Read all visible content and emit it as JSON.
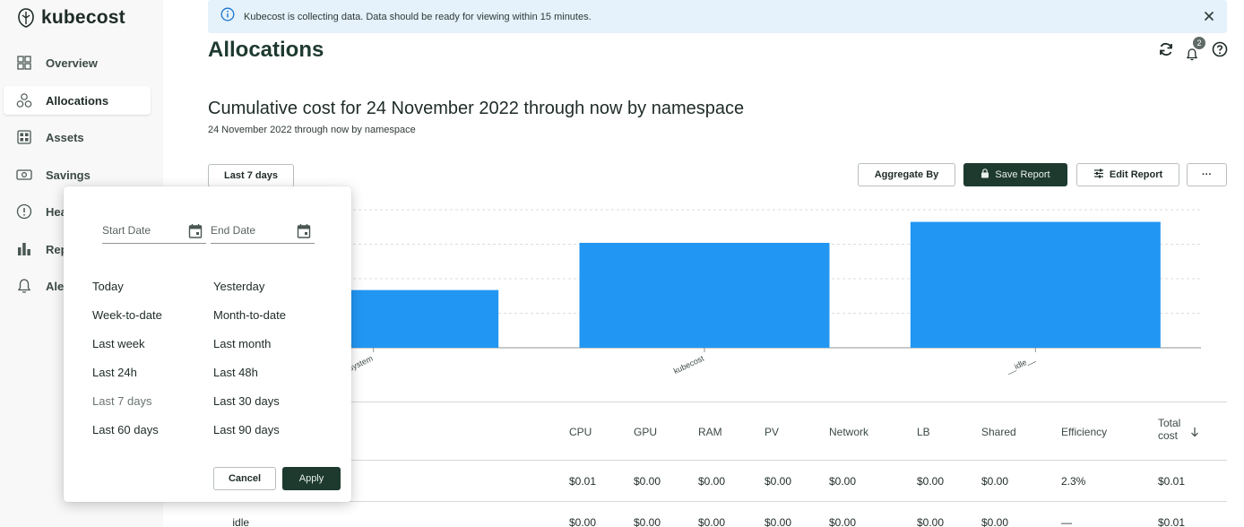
{
  "app": {
    "name": "kubecost"
  },
  "sidebar": {
    "items": [
      {
        "label": "Overview",
        "icon": "grid-icon"
      },
      {
        "label": "Allocations",
        "icon": "allocations-icon"
      },
      {
        "label": "Assets",
        "icon": "assets-icon"
      },
      {
        "label": "Savings",
        "icon": "savings-icon"
      },
      {
        "label": "Hea",
        "icon": "health-icon"
      },
      {
        "label": "Rep",
        "icon": "reports-icon"
      },
      {
        "label": "Ale",
        "icon": "bell-icon"
      }
    ]
  },
  "banner": {
    "text": "Kubecost is collecting data. Data should be ready for viewing within 15 minutes."
  },
  "page": {
    "title": "Allocations"
  },
  "notifications": {
    "count": "2"
  },
  "report": {
    "title": "Cumulative cost for 24 November 2022 through now by namespace",
    "subtitle": "24 November 2022 through now by namespace"
  },
  "toolbar": {
    "range_label": "Last 7 days",
    "aggregate_label": "Aggregate By",
    "save_label": "Save Report",
    "edit_label": "Edit Report",
    "more_label": "···"
  },
  "chart_data": {
    "type": "bar",
    "categories": [
      "kube-system",
      "kubecost",
      "__idle__"
    ],
    "values": [
      0.55,
      1.0,
      1.2
    ],
    "ylim": [
      0,
      1.35
    ],
    "grid": true,
    "color": "#2196f3"
  },
  "table": {
    "columns": [
      "CPU",
      "GPU",
      "RAM",
      "PV",
      "Network",
      "LB",
      "Shared",
      "Efficiency"
    ],
    "total_col": {
      "line1": "Total",
      "line2": "cost"
    },
    "rows": [
      {
        "name": "",
        "cells": [
          "$0.01",
          "$0.00",
          "$0.00",
          "$0.00",
          "$0.00",
          "$0.00",
          "$0.00",
          "2.3%"
        ],
        "total": "$0.01"
      },
      {
        "name": "__idle__",
        "cells": [
          "$0.00",
          "$0.00",
          "$0.00",
          "$0.00",
          "$0.00",
          "$0.00",
          "$0.00",
          "—"
        ],
        "total": "$0.01"
      }
    ]
  },
  "datepicker": {
    "start_placeholder": "Start Date",
    "end_placeholder": "End Date",
    "presets_left": [
      "Today",
      "Week-to-date",
      "Last week",
      "Last 24h",
      "Last 7 days",
      "Last 60 days"
    ],
    "presets_right": [
      "Yesterday",
      "Month-to-date",
      "Last month",
      "Last 48h",
      "Last 30 days",
      "Last 90 days"
    ],
    "cancel_label": "Cancel",
    "apply_label": "Apply"
  }
}
